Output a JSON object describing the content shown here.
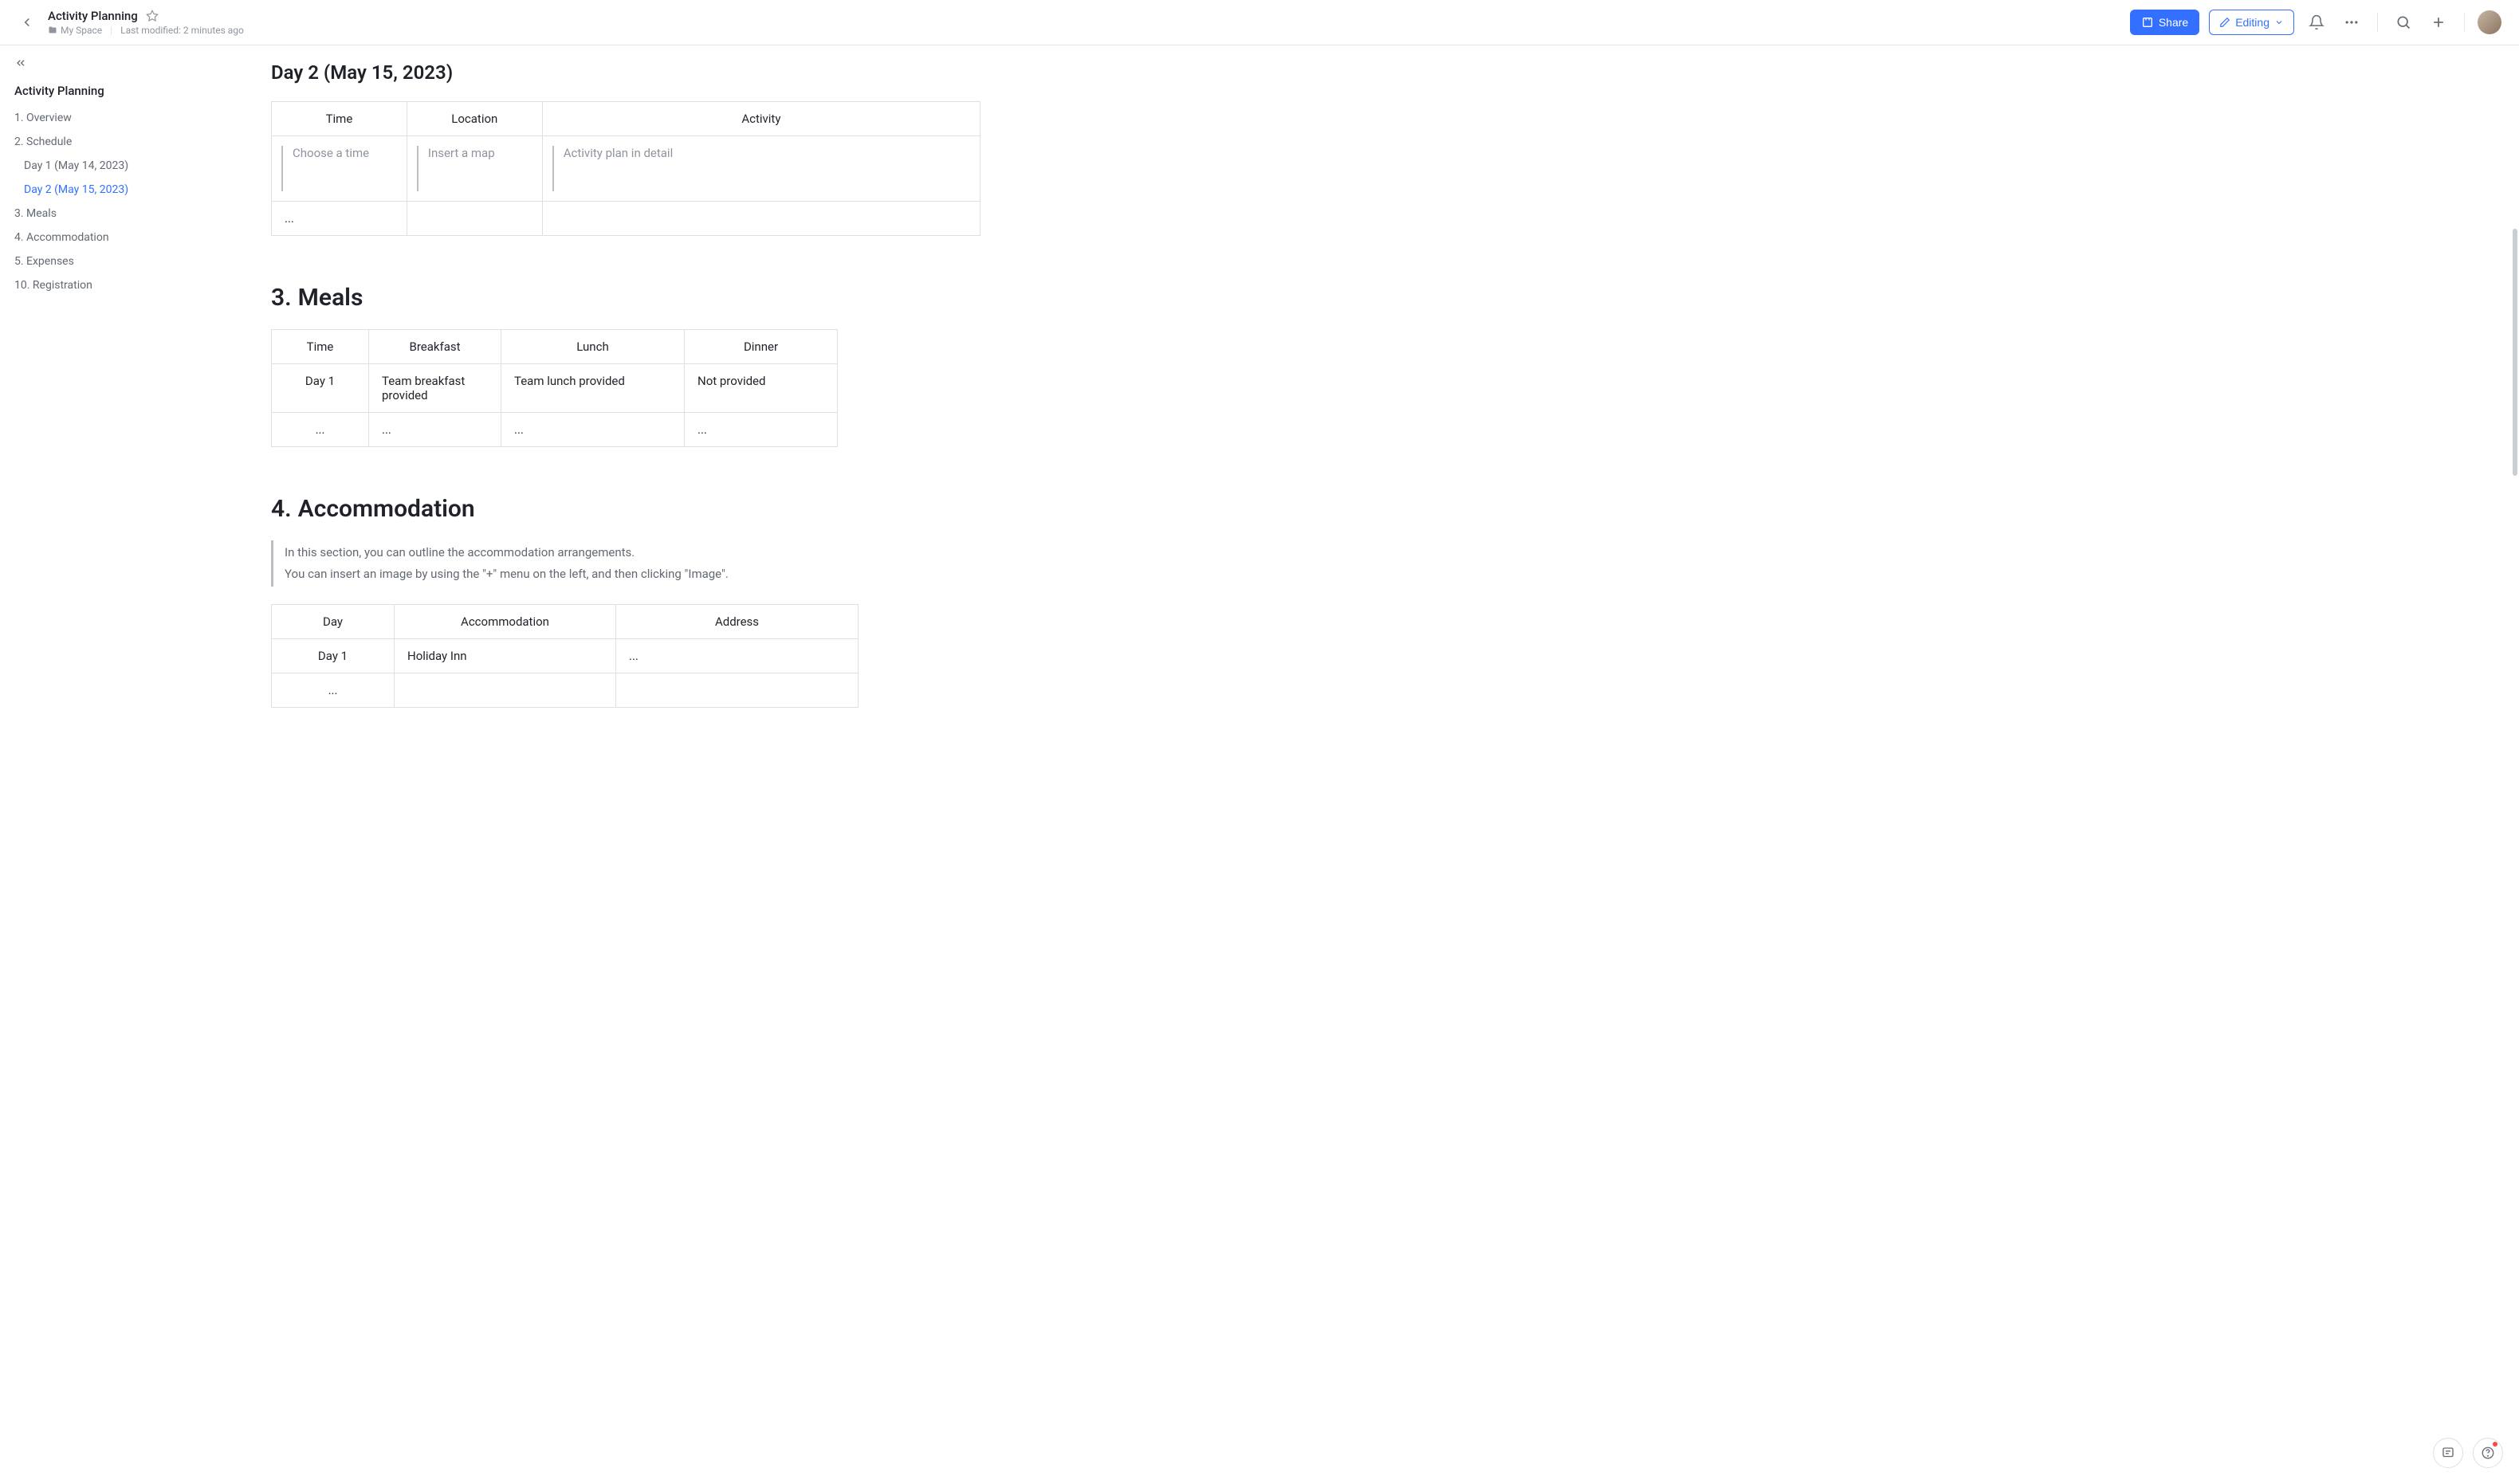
{
  "header": {
    "title": "Activity Planning",
    "space": "My Space",
    "modified": "Last modified: 2 minutes ago",
    "share_label": "Share",
    "editing_label": "Editing"
  },
  "sidebar": {
    "title": "Activity Planning",
    "items": [
      {
        "label": "1. Overview",
        "level": 1,
        "active": false
      },
      {
        "label": "2. Schedule",
        "level": 1,
        "active": false
      },
      {
        "label": "Day 1 (May 14, 2023)",
        "level": 2,
        "active": false
      },
      {
        "label": "Day 2 (May 15, 2023)",
        "level": 2,
        "active": true
      },
      {
        "label": "3. Meals",
        "level": 1,
        "active": false
      },
      {
        "label": "4. Accommodation",
        "level": 1,
        "active": false
      },
      {
        "label": "5. Expenses",
        "level": 1,
        "active": false
      },
      {
        "label": "10. Registration",
        "level": 1,
        "active": false
      }
    ]
  },
  "content": {
    "day2_heading": "Day 2 (May 15, 2023)",
    "schedule": {
      "headers": [
        "Time",
        "Location",
        "Activity"
      ],
      "placeholder_row": [
        "Choose a time",
        "Insert a map",
        "Activity plan in detail"
      ],
      "extra_row": [
        "...",
        "",
        ""
      ]
    },
    "meals_heading_num": "3.",
    "meals_heading_text": "Meals",
    "meals": {
      "headers": [
        "Time",
        "Breakfast",
        "Lunch",
        "Dinner"
      ],
      "rows": [
        [
          "Day 1",
          "Team breakfast provided",
          "Team lunch provided",
          "Not provided"
        ],
        [
          "...",
          "...",
          "...",
          "..."
        ]
      ]
    },
    "accom_heading_num": "4.",
    "accom_heading_text": "Accommodation",
    "accom_quote": [
      "In this section, you can outline the accommodation arrangements.",
      "You can insert an image by using the \"+\" menu on the left, and then clicking \"Image\"."
    ],
    "accom": {
      "headers": [
        "Day",
        "Accommodation",
        "Address"
      ],
      "rows": [
        [
          "Day 1",
          "Holiday Inn",
          "..."
        ],
        [
          "...",
          "",
          ""
        ]
      ]
    }
  }
}
